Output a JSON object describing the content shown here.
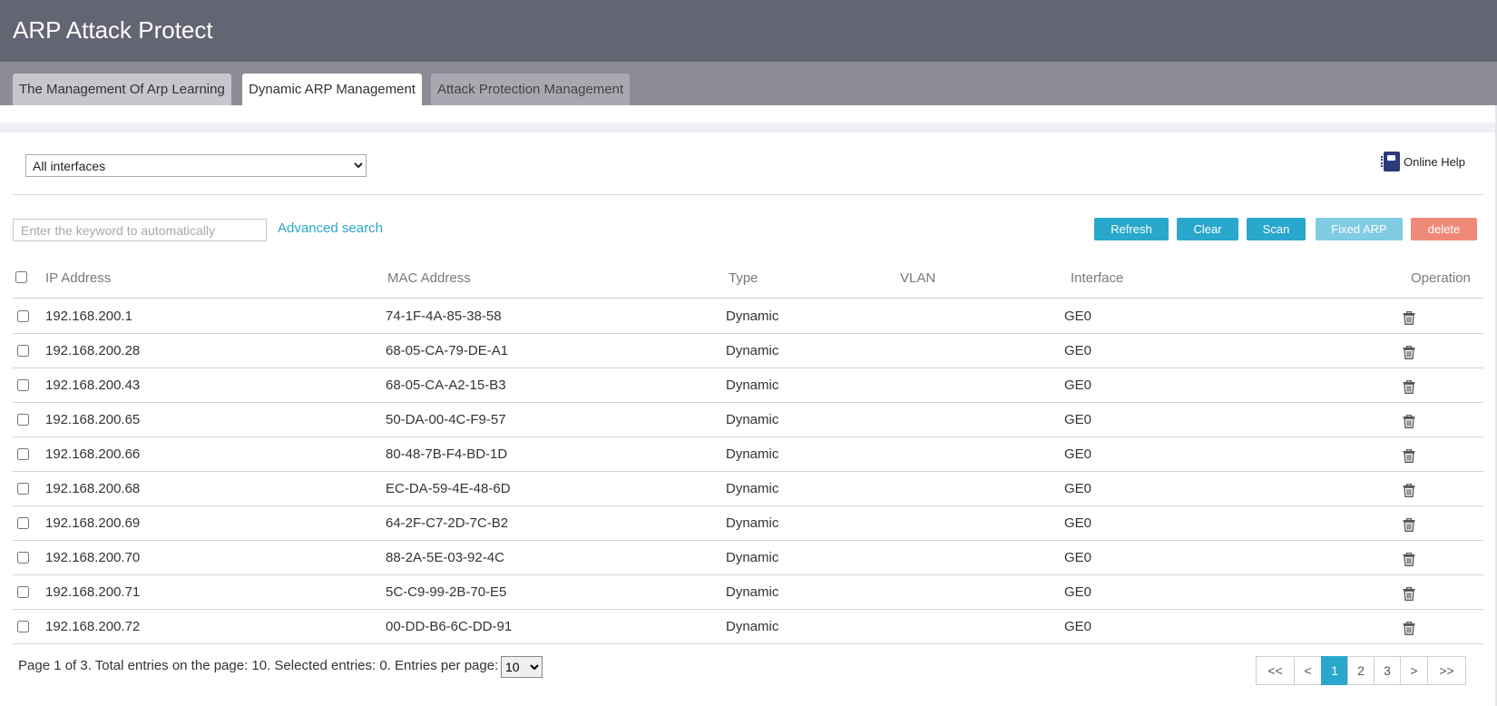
{
  "header": {
    "title": "ARP Attack Protect"
  },
  "tabs": [
    {
      "label": "The Management Of Arp Learning",
      "active": false
    },
    {
      "label": "Dynamic ARP Management",
      "active": true
    },
    {
      "label": "Attack Protection Management",
      "active": false
    }
  ],
  "filter": {
    "interface_selected": "All interfaces"
  },
  "help": {
    "label": "Online Help",
    "icon": "help-book-icon"
  },
  "search": {
    "placeholder": "Enter the keyword to automatically",
    "advanced_label": "Advanced search"
  },
  "toolbar": {
    "refresh_label": "Refresh",
    "clear_label": "Clear",
    "scan_label": "Scan",
    "fixed_label": "Fixed ARP",
    "delete_label": "delete"
  },
  "table": {
    "headers": {
      "ip": "IP Address",
      "mac": "MAC Address",
      "type": "Type",
      "vlan": "VLAN",
      "interface": "Interface",
      "operation": "Operation"
    },
    "rows": [
      {
        "ip": "192.168.200.1",
        "mac": "74-1F-4A-85-38-58",
        "type": "Dynamic",
        "vlan": "",
        "interface": "GE0"
      },
      {
        "ip": "192.168.200.28",
        "mac": "68-05-CA-79-DE-A1",
        "type": "Dynamic",
        "vlan": "",
        "interface": "GE0"
      },
      {
        "ip": "192.168.200.43",
        "mac": "68-05-CA-A2-15-B3",
        "type": "Dynamic",
        "vlan": "",
        "interface": "GE0"
      },
      {
        "ip": "192.168.200.65",
        "mac": "50-DA-00-4C-F9-57",
        "type": "Dynamic",
        "vlan": "",
        "interface": "GE0"
      },
      {
        "ip": "192.168.200.66",
        "mac": "80-48-7B-F4-BD-1D",
        "type": "Dynamic",
        "vlan": "",
        "interface": "GE0"
      },
      {
        "ip": "192.168.200.68",
        "mac": "EC-DA-59-4E-48-6D",
        "type": "Dynamic",
        "vlan": "",
        "interface": "GE0"
      },
      {
        "ip": "192.168.200.69",
        "mac": "64-2F-C7-2D-7C-B2",
        "type": "Dynamic",
        "vlan": "",
        "interface": "GE0"
      },
      {
        "ip": "192.168.200.70",
        "mac": "88-2A-5E-03-92-4C",
        "type": "Dynamic",
        "vlan": "",
        "interface": "GE0"
      },
      {
        "ip": "192.168.200.71",
        "mac": "5C-C9-99-2B-70-E5",
        "type": "Dynamic",
        "vlan": "",
        "interface": "GE0"
      },
      {
        "ip": "192.168.200.72",
        "mac": "00-DD-B6-6C-DD-91",
        "type": "Dynamic",
        "vlan": "",
        "interface": "GE0"
      }
    ]
  },
  "footer": {
    "summary": "Page 1 of 3. Total entries on the page: 10. Selected entries: 0. Entries per page:",
    "per_page": "10",
    "pager": [
      "<<",
      "<",
      "1",
      "2",
      "3",
      ">",
      ">>"
    ],
    "current_page": "1"
  },
  "colors": {
    "header_bg": "#646572",
    "tabbar_bg": "#8c8b96",
    "accent": "#2aa7cd",
    "danger": "#f08a78"
  }
}
